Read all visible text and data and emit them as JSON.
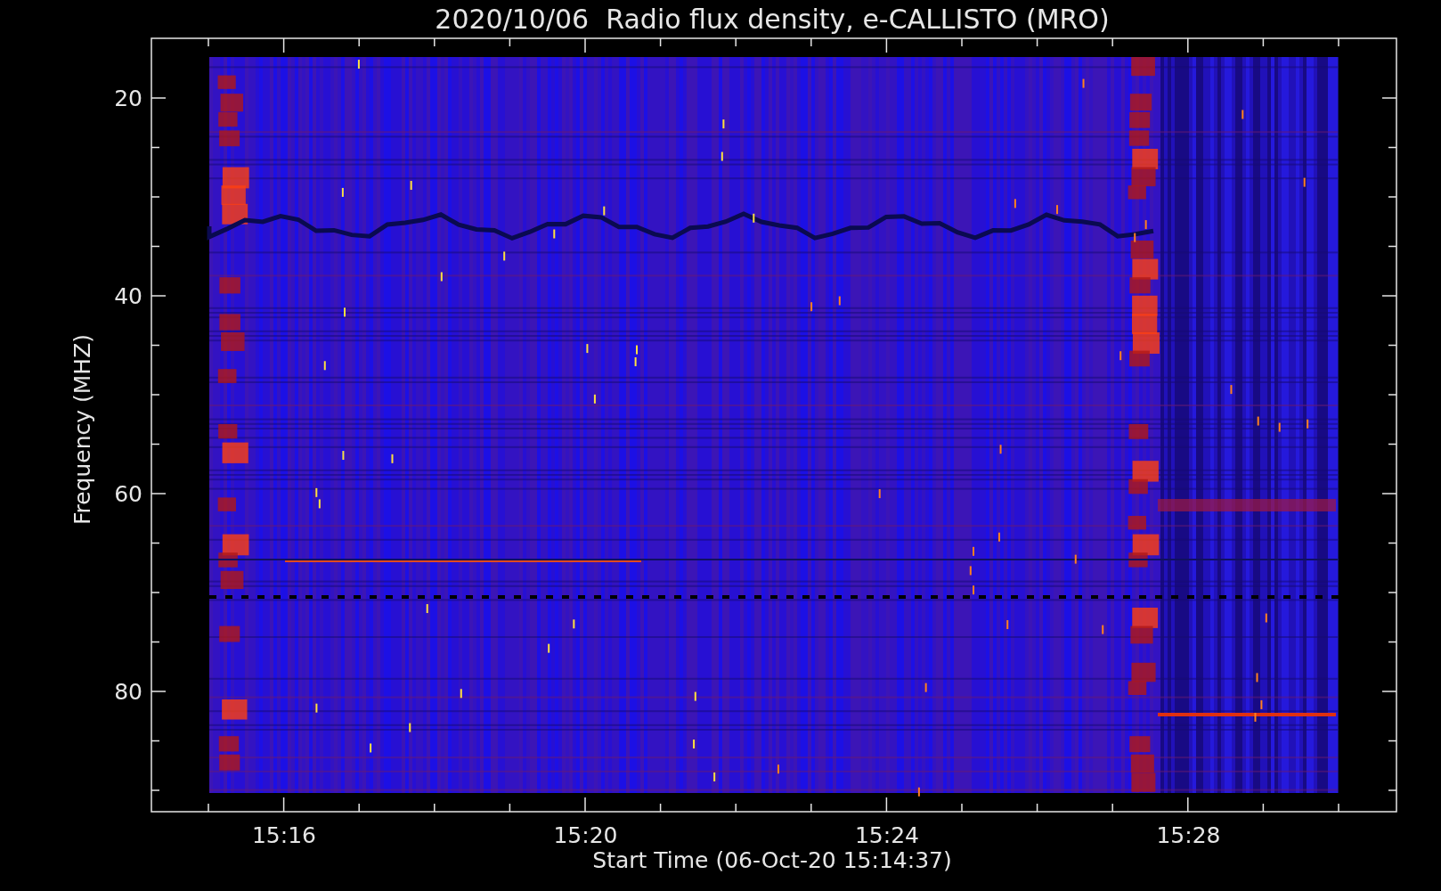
{
  "title": "2020/10/06  Radio flux density, e-CALLISTO (MRO)",
  "x_axis": {
    "label": "Start Time (06-Oct-20 15:14:37)",
    "ticks": [
      "15:16",
      "15:20",
      "15:24",
      "15:28"
    ]
  },
  "y_axis": {
    "label": "Frequency (MHZ)",
    "ticks": [
      "20",
      "40",
      "60",
      "80"
    ]
  }
}
